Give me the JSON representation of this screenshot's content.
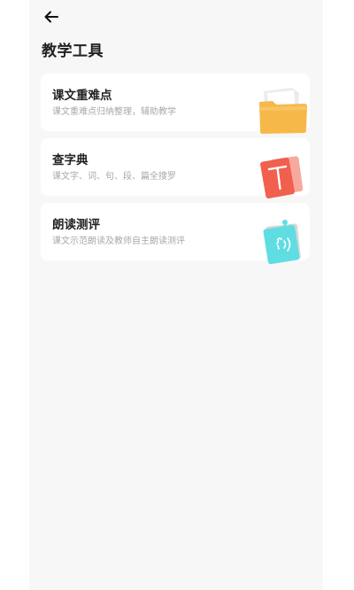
{
  "header": {
    "back_icon": "arrow-left-icon",
    "title": "教学工具"
  },
  "tools": [
    {
      "title": "课文重难点",
      "subtitle": "课文重难点归纳整理，辅助教学",
      "icon": "folder-icon",
      "color": "#f7b84a"
    },
    {
      "title": "查字典",
      "subtitle": "课文字、词、句、段、篇全搜罗",
      "icon": "dictionary-book-icon",
      "color": "#f0604d"
    },
    {
      "title": "朗读测评",
      "subtitle": "课文示范朗读及教师自主朗读测评",
      "icon": "speech-assessment-icon",
      "color": "#5fdde2"
    }
  ]
}
